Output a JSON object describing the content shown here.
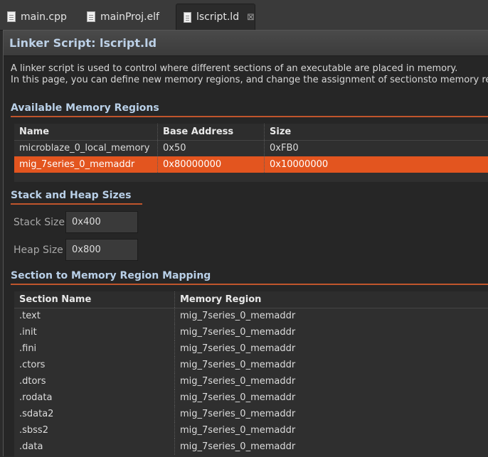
{
  "tabs": [
    {
      "label": "main.cpp",
      "icon": "cpp-file-icon",
      "active": false
    },
    {
      "label": "mainProj.elf",
      "icon": "elf-file-icon",
      "active": false
    },
    {
      "label": "lscript.ld",
      "icon": "linker-script-file-icon",
      "active": true,
      "close": "⊠"
    }
  ],
  "header": {
    "title": "Linker Script: lscript.ld"
  },
  "intro": {
    "line1": "A linker script is used to control where different sections of an executable are placed in memory.",
    "line2": "In this page, you can define new memory regions, and change the assignment of sectionsto memory re"
  },
  "memory_regions": {
    "title": "Available Memory Regions",
    "columns": [
      "Name",
      "Base Address",
      "Size"
    ],
    "rows": [
      {
        "name": "microblaze_0_local_memory",
        "base": "0x50",
        "size": "0xFB0",
        "selected": false
      },
      {
        "name": "mig_7series_0_memaddr",
        "base": "0x80000000",
        "size": "0x10000000",
        "selected": true
      }
    ]
  },
  "stack_heap": {
    "title": "Stack and Heap Sizes",
    "stack_label": "Stack Size",
    "stack_value": "0x400",
    "heap_label": "Heap Size",
    "heap_value": "0x800"
  },
  "section_mapping": {
    "title": "Section to Memory Region Mapping",
    "columns": [
      "Section Name",
      "Memory Region"
    ],
    "rows": [
      {
        "section": ".text",
        "region": "mig_7series_0_memaddr"
      },
      {
        "section": ".init",
        "region": "mig_7series_0_memaddr"
      },
      {
        "section": ".fini",
        "region": "mig_7series_0_memaddr"
      },
      {
        "section": ".ctors",
        "region": "mig_7series_0_memaddr"
      },
      {
        "section": ".dtors",
        "region": "mig_7series_0_memaddr"
      },
      {
        "section": ".rodata",
        "region": "mig_7series_0_memaddr"
      },
      {
        "section": ".sdata2",
        "region": "mig_7series_0_memaddr"
      },
      {
        "section": ".sbss2",
        "region": "mig_7series_0_memaddr"
      },
      {
        "section": ".data",
        "region": "mig_7series_0_memaddr"
      }
    ]
  },
  "colors": {
    "selection": "#e3551f",
    "section_rule": "#c0552c",
    "section_title": "#b9d0e8"
  }
}
